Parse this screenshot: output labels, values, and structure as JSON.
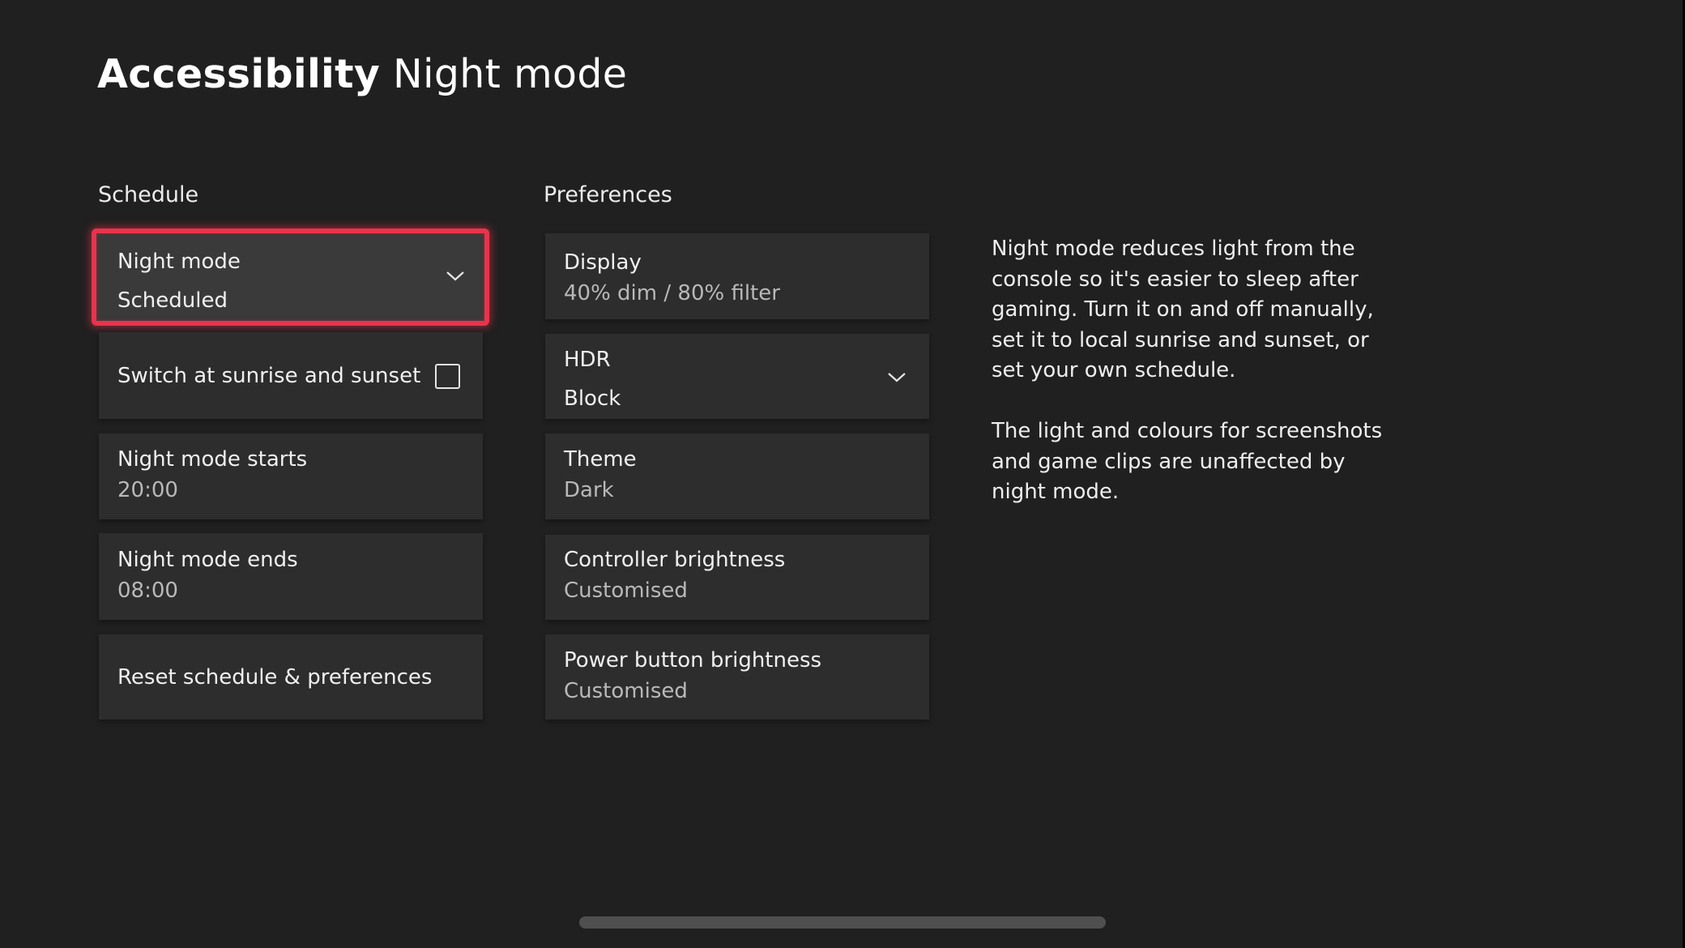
{
  "header": {
    "title_strong": "Accessibility",
    "title_light": "Night mode"
  },
  "schedule": {
    "heading": "Schedule",
    "night_mode": {
      "label": "Night mode",
      "value": "Scheduled",
      "icon": "chevron-down-icon",
      "focused": true
    },
    "sunrise_sunset": {
      "label": "Switch at sunrise and sunset",
      "checked": false,
      "icon": "checkbox-icon"
    },
    "starts": {
      "label": "Night mode starts",
      "value": "20:00"
    },
    "ends": {
      "label": "Night mode ends",
      "value": "08:00"
    },
    "reset": {
      "label": "Reset schedule & preferences"
    }
  },
  "preferences": {
    "heading": "Preferences",
    "items": [
      {
        "label": "Display",
        "value": "40% dim / 80% filter"
      },
      {
        "label": "HDR",
        "value": "Block",
        "icon": "chevron-down-icon"
      },
      {
        "label": "Theme",
        "value": "Dark"
      },
      {
        "label": "Controller brightness",
        "value": "Customised"
      },
      {
        "label": "Power button brightness",
        "value": "Customised"
      }
    ]
  },
  "description": {
    "paragraphs": [
      "Night mode reduces light from the console so it's easier to sleep after gaming. Turn it on and off manually, set it to local sunrise and sunset, or set your own schedule.",
      "The light and colours for screenshots and game clips are unaffected by night mode."
    ]
  },
  "colors": {
    "background": "#202020",
    "card": "#2d2d2d",
    "card_focused": "#3a3a3a",
    "focus_accent": "#e8334c",
    "secondary_text": "#b9b9b9",
    "scrollbar": "#4f4f4f"
  }
}
